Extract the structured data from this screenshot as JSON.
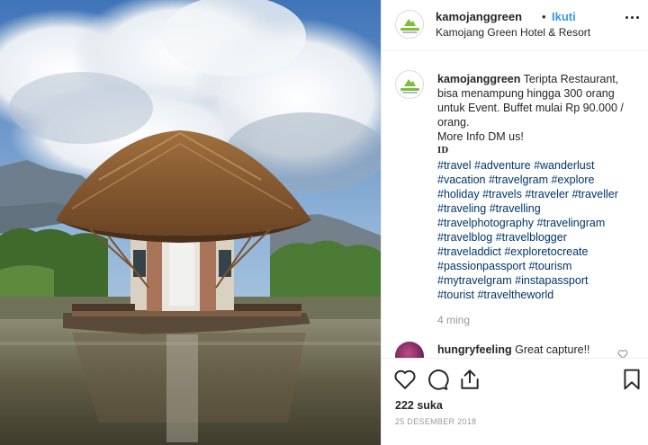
{
  "post": {
    "username": "kamojanggreen",
    "separator": "•",
    "follow_label": "Ikuti",
    "location": "Kamojang Green Hotel & Resort",
    "caption_username": "kamojanggreen",
    "caption_lines": [
      "Teripta Restaurant,",
      "bisa menampung hingga 300 orang",
      "untuk Event. Buffet mulai Rp 90.000 /",
      "orang.",
      "More Info DM us!"
    ],
    "caption_id": "ID",
    "hashtags": [
      [
        "#travel",
        "#adventure",
        "#wanderlust"
      ],
      [
        "#vacation",
        "#travelgram",
        "#explore"
      ],
      [
        "#holiday",
        "#travels",
        "#traveler",
        "#traveller"
      ],
      [
        "#traveling",
        "#travelling"
      ],
      [
        "#travelphotography",
        "#travelingram"
      ],
      [
        "#travelblog",
        "#travelblogger"
      ],
      [
        "#traveladdict",
        "#exploretocreate"
      ],
      [
        "#passionpassport",
        "#tourism"
      ],
      [
        "#mytravelgram",
        "#instapassport"
      ],
      [
        "#tourist",
        "#traveltheworld"
      ]
    ],
    "time_ago": "4 ming"
  },
  "comment": {
    "username": "hungryfeeling",
    "text": "Great capture!!"
  },
  "footer": {
    "likes": "222 suka",
    "date": "25 DESEMBER 2018"
  },
  "icons": {
    "like": "heart-icon",
    "comment": "comment-icon",
    "share": "share-icon",
    "save": "bookmark-icon",
    "more": "more-options-icon"
  },
  "colors": {
    "follow_blue": "#3897f0",
    "hashtag_blue": "#003569",
    "text": "#262626",
    "muted": "#999999",
    "brand_green": "#7cbf3b"
  }
}
